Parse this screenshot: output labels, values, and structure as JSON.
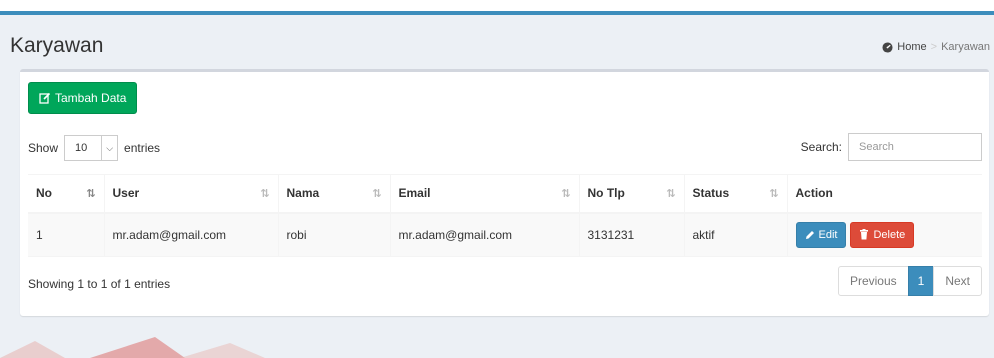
{
  "header": {
    "title": "Karyawan",
    "breadcrumb": {
      "home": "Home",
      "current": "Karyawan"
    }
  },
  "toolbar": {
    "add_label": "Tambah Data"
  },
  "length": {
    "show": "Show",
    "value": "10",
    "entries": "entries"
  },
  "search": {
    "label": "Search:",
    "placeholder": "Search"
  },
  "table": {
    "columns": [
      "No",
      "User",
      "Nama",
      "Email",
      "No Tlp",
      "Status",
      "Action"
    ],
    "rows": [
      {
        "no": "1",
        "user": "mr.adam@gmail.com",
        "nama": "robi",
        "email": "mr.adam@gmail.com",
        "no_tlp": "3131231",
        "status": "aktif"
      }
    ],
    "actions": {
      "edit": "Edit",
      "delete": "Delete"
    }
  },
  "footer": {
    "info": "Showing 1 to 1 of 1 entries",
    "pagination": {
      "previous": "Previous",
      "page": "1",
      "next": "Next"
    }
  },
  "colors": {
    "primary": "#3c8dbc",
    "success": "#00a65a",
    "danger": "#dd4b39",
    "background": "#ecf0f5"
  }
}
